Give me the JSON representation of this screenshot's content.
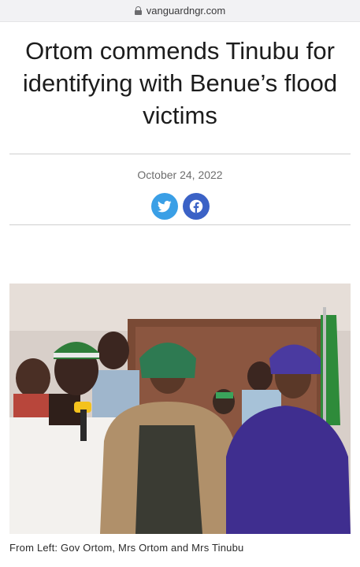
{
  "browser": {
    "url": "vanguardngr.com"
  },
  "article": {
    "headline": "Ortom commends Tinubu for identifying with Benue’s flood victims",
    "date": "October 24, 2022",
    "caption": "From Left: Gov Ortom, Mrs Ortom and Mrs Tinubu"
  },
  "share": {
    "twitter_icon": "twitter-bird-icon",
    "facebook_icon": "facebook-f-icon",
    "twitter_color": "#3a9fe6",
    "facebook_color": "#3b62c6"
  },
  "colors": {
    "divider": "#cfcfcf",
    "date_text": "#6d6d6d"
  }
}
